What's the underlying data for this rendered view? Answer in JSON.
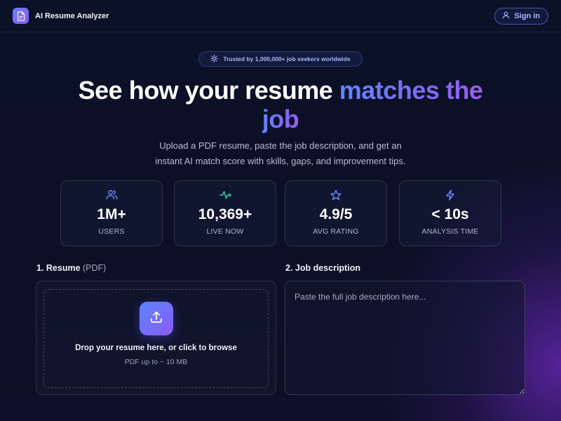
{
  "app": {
    "name": "AI Resume Analyzer",
    "sign_in_label": "Sign in"
  },
  "badge": {
    "text": "Trusted by 1,000,000+ job seekers worldwide"
  },
  "hero": {
    "title_plain": "See how your resume ",
    "title_accent_1": "matches the",
    "title_accent_2": "job",
    "subtitle_line1": "Upload a PDF resume, paste the job description, and get an",
    "subtitle_line2": "instant AI match score with skills, gaps, and improvement tips."
  },
  "stats": [
    {
      "icon": "users-icon",
      "value": "1M+",
      "label": "USERS",
      "color": "#6f8bff"
    },
    {
      "icon": "activity-icon",
      "value": "10,369+",
      "label": "LIVE NOW",
      "color": "#34d399"
    },
    {
      "icon": "star-icon",
      "value": "4.9/5",
      "label": "AVG RATING",
      "color": "#6f8bff"
    },
    {
      "icon": "bolt-icon",
      "value": "< 10s",
      "label": "ANALYSIS TIME",
      "color": "#6f8bff"
    }
  ],
  "resume": {
    "label": "1. Resume",
    "label_suffix": "(PDF)",
    "drop_text": "Drop your resume here, or click to browse",
    "hint": "PDF up to ~ 10 MB"
  },
  "job": {
    "label": "2. Job description",
    "placeholder": "Paste the full job description here..."
  },
  "colors": {
    "accent": "#6b7cff",
    "accent_purple": "#8b5cf6",
    "background": "#0b1127",
    "live_green": "#34d399"
  }
}
